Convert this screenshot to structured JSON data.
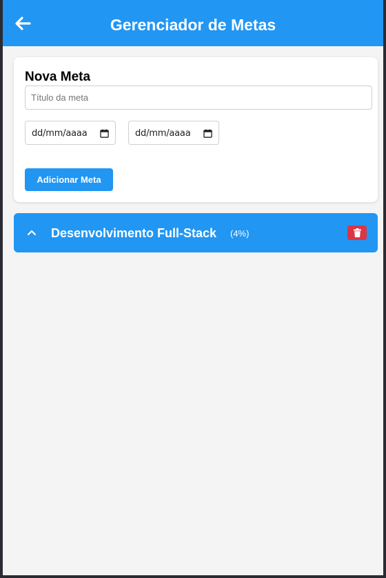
{
  "header": {
    "title": "Gerenciador de Metas",
    "back_icon": "arrow-left-icon",
    "background_color": "#2196f3"
  },
  "new_goal_form": {
    "title": "Nova Meta",
    "title_input": {
      "placeholder": "Título da meta",
      "value": ""
    },
    "start_date": {
      "display": "dd/mm/aaaa",
      "icon": "calendar-icon"
    },
    "end_date": {
      "display": "dd/mm/aaaa",
      "icon": "calendar-icon"
    },
    "add_button_label": "Adicionar Meta"
  },
  "goals": [
    {
      "title": "Desenvolvimento Full-Stack",
      "progress": "(4%)",
      "expand_icon": "chevron-up-icon",
      "delete_icon": "trash-icon",
      "delete_color": "#dc3545"
    }
  ],
  "colors": {
    "primary": "#2196f3",
    "danger": "#dc3545",
    "background": "#f4f4f4"
  }
}
